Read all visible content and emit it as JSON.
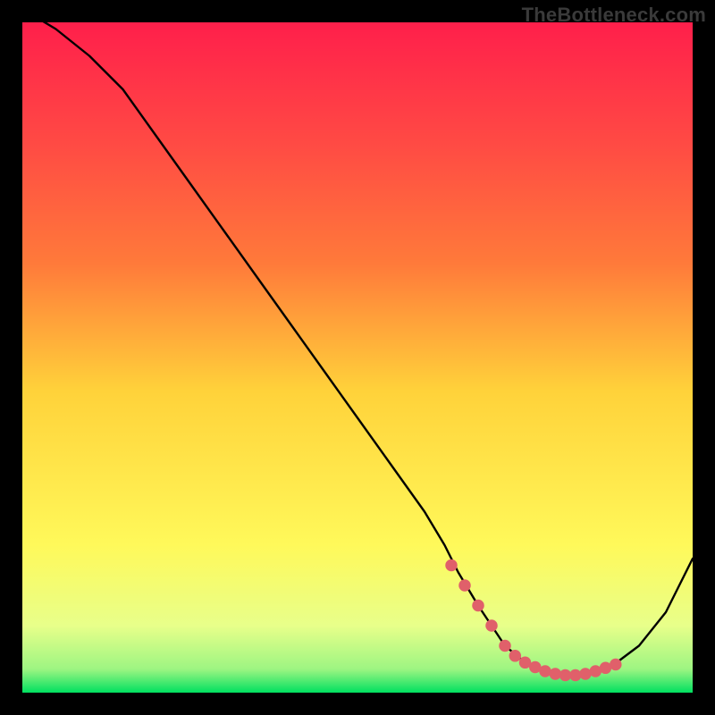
{
  "watermark": "TheBottleneck.com",
  "colors": {
    "background": "#000000",
    "gradient_top": "#ff1f4b",
    "gradient_mid_top": "#ff7a3a",
    "gradient_mid": "#ffd23a",
    "gradient_mid_bottom": "#fff95a",
    "gradient_bottom_soft": "#e8ff8a",
    "gradient_bottom": "#00e060",
    "curve": "#000000",
    "marker": "#e0606a"
  },
  "chart_data": {
    "type": "line",
    "title": "",
    "xlabel": "",
    "ylabel": "",
    "xlim": [
      0,
      100
    ],
    "ylim": [
      0,
      100
    ],
    "legend": false,
    "grid": false,
    "series": [
      {
        "name": "bottleneck_curve",
        "stroke": "curve",
        "x": [
          0,
          5,
          10,
          15,
          20,
          25,
          30,
          35,
          40,
          45,
          50,
          55,
          60,
          63,
          65,
          68,
          70,
          72,
          75,
          78,
          80,
          82,
          85,
          88,
          92,
          96,
          100
        ],
        "values": [
          102,
          99,
          95,
          90,
          83,
          76,
          69,
          62,
          55,
          48,
          41,
          34,
          27,
          22,
          18,
          13,
          10,
          7,
          4.5,
          3,
          2.5,
          2.5,
          3,
          4,
          7,
          12,
          20
        ]
      }
    ],
    "markers": {
      "name": "optimal_band",
      "color": "marker",
      "radius_pct": 0.9,
      "x": [
        64,
        66,
        68,
        70,
        72,
        73.5,
        75,
        76.5,
        78,
        79.5,
        81,
        82.5,
        84,
        85.5,
        87,
        88.5
      ],
      "values": [
        19,
        16,
        13,
        10,
        7,
        5.5,
        4.5,
        3.8,
        3.2,
        2.8,
        2.6,
        2.6,
        2.8,
        3.2,
        3.7,
        4.2
      ]
    }
  }
}
